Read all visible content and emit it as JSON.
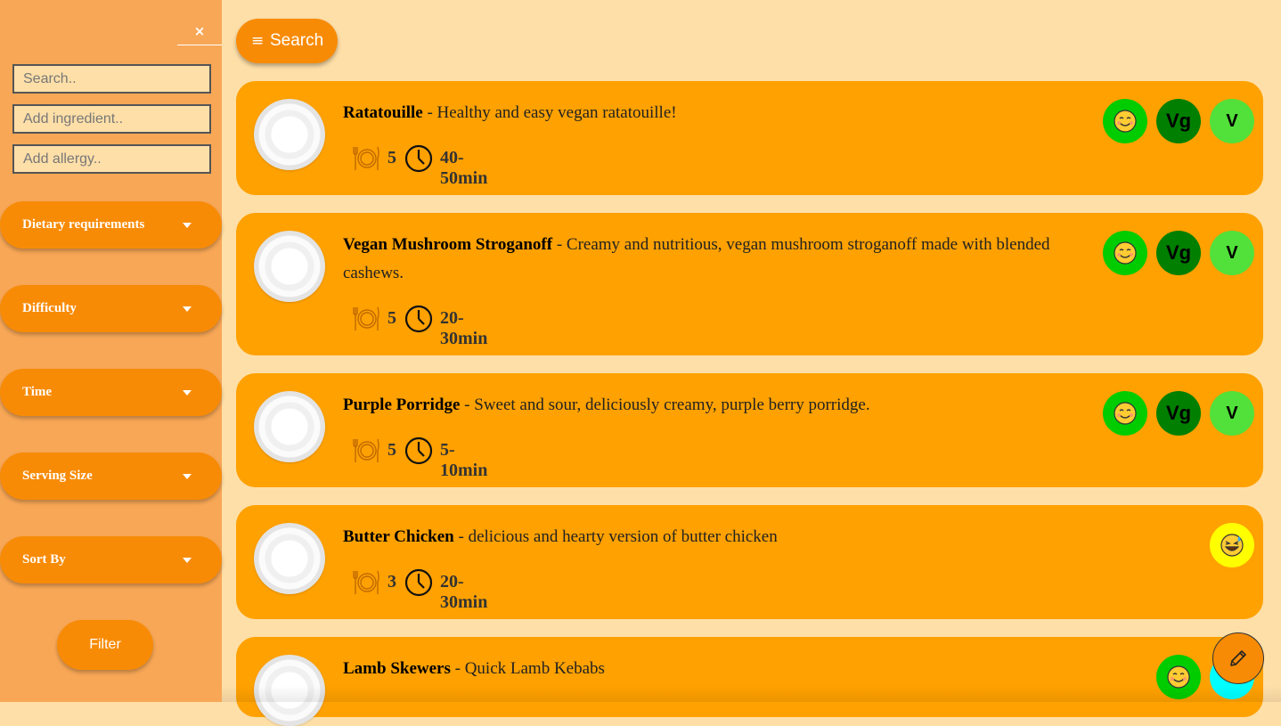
{
  "sidebar": {
    "close_label": "×",
    "search_placeholder": "Search..",
    "ingredient_placeholder": "Add ingredient..",
    "allergy_placeholder": "Add allergy..",
    "filters": [
      "Dietary requirements",
      "Difficulty",
      "Time",
      "Serving Size",
      "Sort By"
    ],
    "filter_button": "Filter"
  },
  "header": {
    "search_button": "Search",
    "menu_icon": "≡"
  },
  "recipes": [
    {
      "title": "Ratatouille",
      "desc": "Healthy and easy vegan ratatouille!",
      "servings": "5",
      "time": "40-50min",
      "badges": [
        "smile",
        "Vg",
        "V"
      ]
    },
    {
      "title": "Vegan Mushroom Stroganoff",
      "desc": "Creamy and nutritious, vegan mushroom stroganoff made with blended cashews.",
      "servings": "5",
      "time": "20-30min",
      "badges": [
        "smile",
        "Vg",
        "V"
      ]
    },
    {
      "title": "Purple Porridge",
      "desc": "Sweet and sour, deliciously creamy, purple berry porridge.",
      "servings": "5",
      "time": "5-10min",
      "badges": [
        "smile",
        "Vg",
        "V"
      ]
    },
    {
      "title": "Butter Chicken",
      "desc": "delicious and hearty version of butter chicken",
      "servings": "3",
      "time": "20-30min",
      "badges": [
        "laugh"
      ]
    },
    {
      "title": "Lamb Skewers",
      "desc": "Quick Lamb Kebabs",
      "servings": "",
      "time": "",
      "badges": [
        "smile",
        "cyan"
      ]
    }
  ],
  "separator": " - ",
  "icons": {
    "edit_button": "pencil-icon",
    "serving": "cutlery-plate-icon",
    "time": "clock-icon",
    "easy_badge": "smiling-face-icon",
    "medium_badge": "grinning-sweat-face-icon"
  },
  "colors": {
    "page_bg": "#fedfa8",
    "sidebar_bg": "#f8a756",
    "accent": "#f88b06",
    "card_bg": "#ffa100",
    "easy": "#00cc00",
    "vegan": "#007f00",
    "vegetarian": "#52e03a",
    "medium": "#ffff00"
  }
}
